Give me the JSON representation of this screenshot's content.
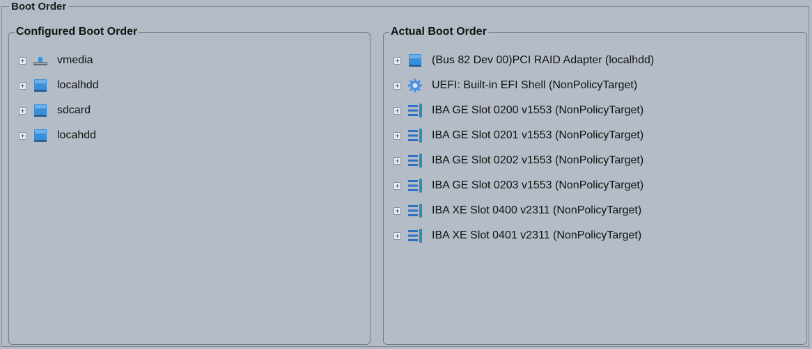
{
  "outer_title": "Boot Order",
  "configured": {
    "title": "Configured Boot Order",
    "items": [
      {
        "label": "vmedia",
        "icon": "vmedia-icon"
      },
      {
        "label": "localhdd",
        "icon": "disk-icon"
      },
      {
        "label": "sdcard",
        "icon": "disk-icon"
      },
      {
        "label": "locahdd",
        "icon": "disk-icon"
      }
    ]
  },
  "actual": {
    "title": "Actual Boot Order",
    "items": [
      {
        "label": "(Bus 82 Dev 00)PCI RAID Adapter (localhdd)",
        "icon": "disk-icon"
      },
      {
        "label": "UEFI: Built-in EFI Shell  (NonPolicyTarget)",
        "icon": "gear-icon"
      },
      {
        "label": "IBA GE Slot 0200 v1553 (NonPolicyTarget)",
        "icon": "network-icon"
      },
      {
        "label": "IBA GE Slot 0201 v1553 (NonPolicyTarget)",
        "icon": "network-icon"
      },
      {
        "label": "IBA GE Slot 0202 v1553 (NonPolicyTarget)",
        "icon": "network-icon"
      },
      {
        "label": "IBA GE Slot 0203 v1553 (NonPolicyTarget)",
        "icon": "network-icon"
      },
      {
        "label": "IBA XE Slot 0400 v2311 (NonPolicyTarget)",
        "icon": "network-icon"
      },
      {
        "label": "IBA XE Slot 0401 v2311 (NonPolicyTarget)",
        "icon": "network-icon"
      }
    ]
  },
  "colors": {
    "background": "#b3bcc6",
    "disk_blue": "#3a8fd8",
    "network_blue": "#2f6fc4",
    "gear_blue": "#4a90e2"
  }
}
